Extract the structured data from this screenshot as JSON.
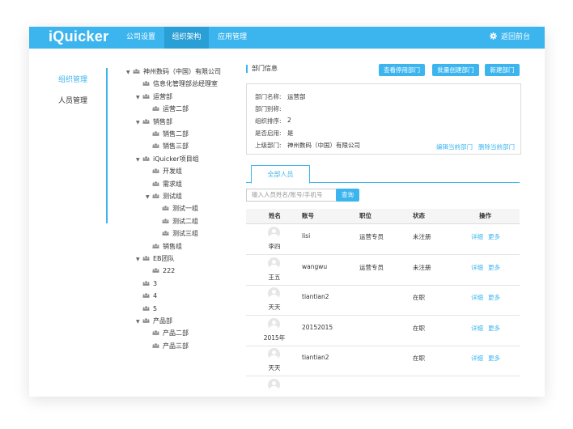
{
  "app": {
    "logo": "iQuicker",
    "return_label": "返回前台"
  },
  "nav": {
    "items": [
      "公司设置",
      "组织架构",
      "应用管理"
    ],
    "active": "组织架构"
  },
  "sidebar": {
    "items": [
      {
        "label": "组织管理",
        "active": true
      },
      {
        "label": "人员管理",
        "active": false
      }
    ]
  },
  "tree": [
    {
      "label": "神州数码（中国）有限公司",
      "expanded": true
    },
    {
      "label": "信息化管理部总经理室"
    },
    {
      "label": "运营部",
      "expanded": true
    },
    {
      "label": "运营二部"
    },
    {
      "label": "销售部",
      "expanded": true
    },
    {
      "label": "销售二部"
    },
    {
      "label": "销售三部"
    },
    {
      "label": "iQuicker项目组",
      "expanded": true
    },
    {
      "label": "开发组"
    },
    {
      "label": "需求组"
    },
    {
      "label": "测试组",
      "expanded": true
    },
    {
      "label": "测试一组"
    },
    {
      "label": "测试二组"
    },
    {
      "label": "测试三组"
    },
    {
      "label": "销售组"
    },
    {
      "label": "EB团队",
      "expanded": true
    },
    {
      "label": "222"
    },
    {
      "label": "3"
    },
    {
      "label": "4"
    },
    {
      "label": "5"
    },
    {
      "label": "产品部",
      "expanded": true
    },
    {
      "label": "产品二部"
    },
    {
      "label": "产品三部"
    }
  ],
  "dept": {
    "header": "部门信息",
    "buttons": {
      "view_disabled": "查看停用部门",
      "batch_create": "批量创建部门",
      "new": "新建部门"
    },
    "fields": [
      {
        "label": "部门名称:",
        "value": "运营部"
      },
      {
        "label": "部门别称:",
        "value": ""
      },
      {
        "label": "组织排序:",
        "value": "2"
      },
      {
        "label": "是否启用:",
        "value": "是"
      },
      {
        "label": "上级部门:",
        "value": "神州数码（中国）有限公司"
      }
    ],
    "edit_link": "编辑当前部门",
    "delete_link": "删除当前部门"
  },
  "members": {
    "tab": "全部人员",
    "search_placeholder": "输入人员姓名/账号/手机号",
    "search_button": "查询",
    "columns": [
      "姓名",
      "账号",
      "职位",
      "状态",
      "操作"
    ],
    "rows": [
      {
        "name": "李四",
        "account": "lisi",
        "position": "运营专员",
        "status": "未注册",
        "detail": "详细",
        "more": "更多"
      },
      {
        "name": "王五",
        "account": "wangwu",
        "position": "运营专员",
        "status": "未注册",
        "detail": "详细",
        "more": "更多"
      },
      {
        "name": "天天",
        "account": "tiantian2",
        "position": "",
        "status": "在职",
        "detail": "详细",
        "more": "更多"
      },
      {
        "name": "2015年",
        "account": "20152015",
        "position": "",
        "status": "在职",
        "detail": "详细",
        "more": "更多"
      },
      {
        "name": "天天",
        "account": "tiantian2",
        "position": "",
        "status": "在职",
        "detail": "详细",
        "more": "更多"
      }
    ]
  },
  "colors": {
    "accent": "#3cb5ef",
    "nav_active": "#2a9fd6"
  }
}
